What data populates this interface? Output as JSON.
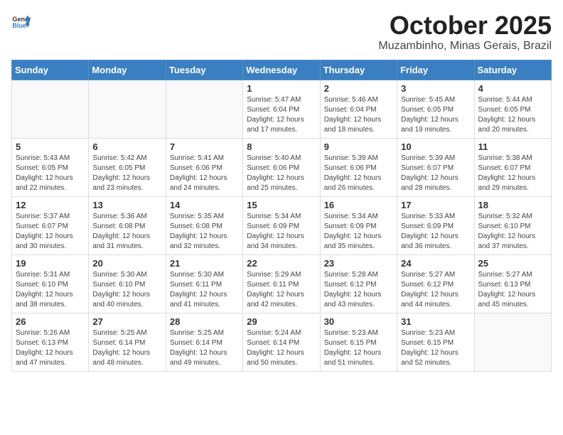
{
  "header": {
    "logo_general": "General",
    "logo_blue": "Blue",
    "month": "October 2025",
    "location": "Muzambinho, Minas Gerais, Brazil"
  },
  "weekdays": [
    "Sunday",
    "Monday",
    "Tuesday",
    "Wednesday",
    "Thursday",
    "Friday",
    "Saturday"
  ],
  "weeks": [
    [
      {
        "day": "",
        "sunrise": "",
        "sunset": "",
        "daylight": ""
      },
      {
        "day": "",
        "sunrise": "",
        "sunset": "",
        "daylight": ""
      },
      {
        "day": "",
        "sunrise": "",
        "sunset": "",
        "daylight": ""
      },
      {
        "day": "1",
        "sunrise": "Sunrise: 5:47 AM",
        "sunset": "Sunset: 6:04 PM",
        "daylight": "Daylight: 12 hours and 17 minutes."
      },
      {
        "day": "2",
        "sunrise": "Sunrise: 5:46 AM",
        "sunset": "Sunset: 6:04 PM",
        "daylight": "Daylight: 12 hours and 18 minutes."
      },
      {
        "day": "3",
        "sunrise": "Sunrise: 5:45 AM",
        "sunset": "Sunset: 6:05 PM",
        "daylight": "Daylight: 12 hours and 19 minutes."
      },
      {
        "day": "4",
        "sunrise": "Sunrise: 5:44 AM",
        "sunset": "Sunset: 6:05 PM",
        "daylight": "Daylight: 12 hours and 20 minutes."
      }
    ],
    [
      {
        "day": "5",
        "sunrise": "Sunrise: 5:43 AM",
        "sunset": "Sunset: 6:05 PM",
        "daylight": "Daylight: 12 hours and 22 minutes."
      },
      {
        "day": "6",
        "sunrise": "Sunrise: 5:42 AM",
        "sunset": "Sunset: 6:05 PM",
        "daylight": "Daylight: 12 hours and 23 minutes."
      },
      {
        "day": "7",
        "sunrise": "Sunrise: 5:41 AM",
        "sunset": "Sunset: 6:06 PM",
        "daylight": "Daylight: 12 hours and 24 minutes."
      },
      {
        "day": "8",
        "sunrise": "Sunrise: 5:40 AM",
        "sunset": "Sunset: 6:06 PM",
        "daylight": "Daylight: 12 hours and 25 minutes."
      },
      {
        "day": "9",
        "sunrise": "Sunrise: 5:39 AM",
        "sunset": "Sunset: 6:06 PM",
        "daylight": "Daylight: 12 hours and 26 minutes."
      },
      {
        "day": "10",
        "sunrise": "Sunrise: 5:39 AM",
        "sunset": "Sunset: 6:07 PM",
        "daylight": "Daylight: 12 hours and 28 minutes."
      },
      {
        "day": "11",
        "sunrise": "Sunrise: 5:38 AM",
        "sunset": "Sunset: 6:07 PM",
        "daylight": "Daylight: 12 hours and 29 minutes."
      }
    ],
    [
      {
        "day": "12",
        "sunrise": "Sunrise: 5:37 AM",
        "sunset": "Sunset: 6:07 PM",
        "daylight": "Daylight: 12 hours and 30 minutes."
      },
      {
        "day": "13",
        "sunrise": "Sunrise: 5:36 AM",
        "sunset": "Sunset: 6:08 PM",
        "daylight": "Daylight: 12 hours and 31 minutes."
      },
      {
        "day": "14",
        "sunrise": "Sunrise: 5:35 AM",
        "sunset": "Sunset: 6:08 PM",
        "daylight": "Daylight: 12 hours and 32 minutes."
      },
      {
        "day": "15",
        "sunrise": "Sunrise: 5:34 AM",
        "sunset": "Sunset: 6:09 PM",
        "daylight": "Daylight: 12 hours and 34 minutes."
      },
      {
        "day": "16",
        "sunrise": "Sunrise: 5:34 AM",
        "sunset": "Sunset: 6:09 PM",
        "daylight": "Daylight: 12 hours and 35 minutes."
      },
      {
        "day": "17",
        "sunrise": "Sunrise: 5:33 AM",
        "sunset": "Sunset: 6:09 PM",
        "daylight": "Daylight: 12 hours and 36 minutes."
      },
      {
        "day": "18",
        "sunrise": "Sunrise: 5:32 AM",
        "sunset": "Sunset: 6:10 PM",
        "daylight": "Daylight: 12 hours and 37 minutes."
      }
    ],
    [
      {
        "day": "19",
        "sunrise": "Sunrise: 5:31 AM",
        "sunset": "Sunset: 6:10 PM",
        "daylight": "Daylight: 12 hours and 38 minutes."
      },
      {
        "day": "20",
        "sunrise": "Sunrise: 5:30 AM",
        "sunset": "Sunset: 6:10 PM",
        "daylight": "Daylight: 12 hours and 40 minutes."
      },
      {
        "day": "21",
        "sunrise": "Sunrise: 5:30 AM",
        "sunset": "Sunset: 6:11 PM",
        "daylight": "Daylight: 12 hours and 41 minutes."
      },
      {
        "day": "22",
        "sunrise": "Sunrise: 5:29 AM",
        "sunset": "Sunset: 6:11 PM",
        "daylight": "Daylight: 12 hours and 42 minutes."
      },
      {
        "day": "23",
        "sunrise": "Sunrise: 5:28 AM",
        "sunset": "Sunset: 6:12 PM",
        "daylight": "Daylight: 12 hours and 43 minutes."
      },
      {
        "day": "24",
        "sunrise": "Sunrise: 5:27 AM",
        "sunset": "Sunset: 6:12 PM",
        "daylight": "Daylight: 12 hours and 44 minutes."
      },
      {
        "day": "25",
        "sunrise": "Sunrise: 5:27 AM",
        "sunset": "Sunset: 6:13 PM",
        "daylight": "Daylight: 12 hours and 45 minutes."
      }
    ],
    [
      {
        "day": "26",
        "sunrise": "Sunrise: 5:26 AM",
        "sunset": "Sunset: 6:13 PM",
        "daylight": "Daylight: 12 hours and 47 minutes."
      },
      {
        "day": "27",
        "sunrise": "Sunrise: 5:25 AM",
        "sunset": "Sunset: 6:14 PM",
        "daylight": "Daylight: 12 hours and 48 minutes."
      },
      {
        "day": "28",
        "sunrise": "Sunrise: 5:25 AM",
        "sunset": "Sunset: 6:14 PM",
        "daylight": "Daylight: 12 hours and 49 minutes."
      },
      {
        "day": "29",
        "sunrise": "Sunrise: 5:24 AM",
        "sunset": "Sunset: 6:14 PM",
        "daylight": "Daylight: 12 hours and 50 minutes."
      },
      {
        "day": "30",
        "sunrise": "Sunrise: 5:23 AM",
        "sunset": "Sunset: 6:15 PM",
        "daylight": "Daylight: 12 hours and 51 minutes."
      },
      {
        "day": "31",
        "sunrise": "Sunrise: 5:23 AM",
        "sunset": "Sunset: 6:15 PM",
        "daylight": "Daylight: 12 hours and 52 minutes."
      },
      {
        "day": "",
        "sunrise": "",
        "sunset": "",
        "daylight": ""
      }
    ]
  ]
}
